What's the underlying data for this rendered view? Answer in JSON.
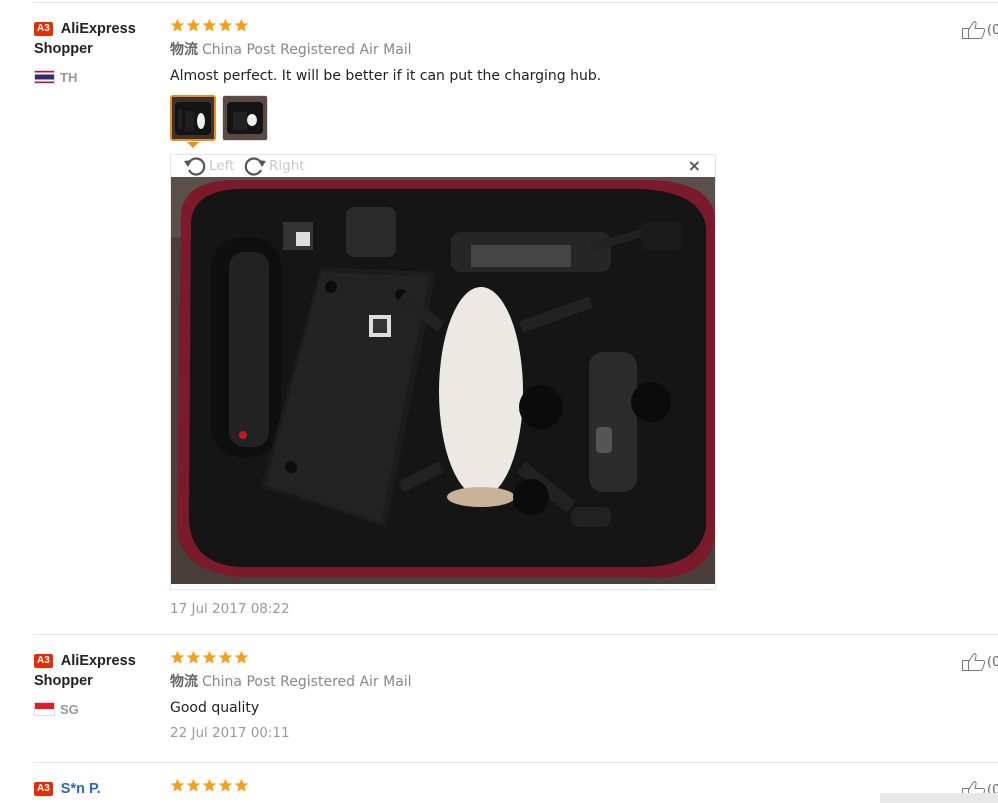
{
  "reviews": [
    {
      "badge": "A3",
      "name_line1": "AliExpress",
      "name_line2": "Shopper",
      "country_code": "TH",
      "flag": "thailand-flag",
      "stars": 5,
      "logistics_label": "物流",
      "logistics_value": "China Post Registered Air Mail",
      "text": "Almost perfect. It will be better if it can put the charging hub.",
      "thumbnails": 2,
      "viewer": {
        "rotate_left": "Left",
        "rotate_right": "Right",
        "close": "×"
      },
      "date": "17 Jul 2017 08:22",
      "like_count": "(0"
    },
    {
      "badge": "A3",
      "name_line1": "AliExpress",
      "name_line2": "Shopper",
      "country_code": "SG",
      "flag": "singapore-flag",
      "stars": 5,
      "logistics_label": "物流",
      "logistics_value": "China Post Registered Air Mail",
      "text": "Good quality",
      "date": "22 Jul 2017 00:11",
      "like_count": "(0"
    },
    {
      "badge": "A3",
      "name_line1": "S*n P.",
      "stars": 5,
      "like_count": "(0"
    }
  ],
  "colors": {
    "badge": "#e62e04",
    "star": "#f6a01a",
    "active_thumb_border": "#f08c1e",
    "link_name": "#2a66c8"
  },
  "icons": [
    "star-icon",
    "thumbs-up-icon",
    "rotate-left-icon",
    "rotate-right-icon",
    "close-icon"
  ]
}
